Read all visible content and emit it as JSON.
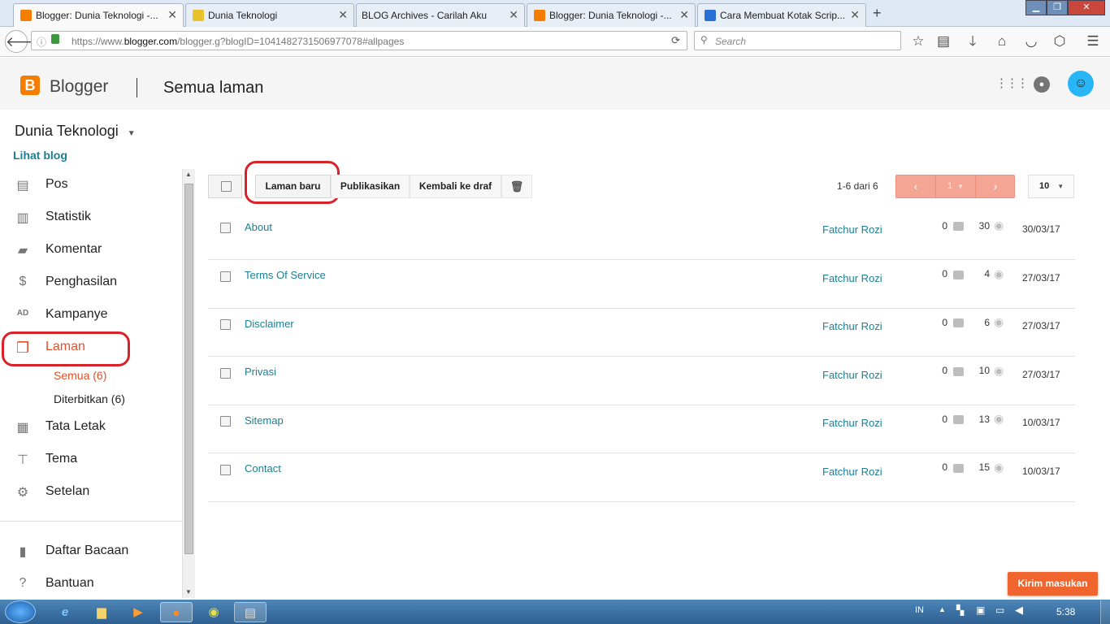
{
  "browser": {
    "tabs": [
      {
        "title": "Blogger: Dunia Teknologi -...",
        "active": true,
        "favicon": "blogger-icon"
      },
      {
        "title": "Dunia Teknologi",
        "active": false,
        "favicon": "page-icon"
      },
      {
        "title": "BLOG Archives - Carilah Aku",
        "active": false,
        "favicon": "none"
      },
      {
        "title": "Blogger: Dunia Teknologi -...",
        "active": false,
        "favicon": "blogger-icon"
      },
      {
        "title": "Cara Membuat Kotak Scrip...",
        "active": false,
        "favicon": "d-icon"
      }
    ],
    "url_prefix": "https://www.",
    "url_domain": "blogger.com",
    "url_rest": "/blogger.g?blogID=1041482731506977078#allpages",
    "search_placeholder": "Search"
  },
  "header": {
    "brand": "Blogger",
    "page_title": "Semua laman"
  },
  "sidebar": {
    "blog_name": "Dunia Teknologi",
    "view_blog": "Lihat blog",
    "items": [
      {
        "label": "Pos",
        "icon": "posts-icon"
      },
      {
        "label": "Statistik",
        "icon": "stats-icon"
      },
      {
        "label": "Komentar",
        "icon": "comment-icon"
      },
      {
        "label": "Penghasilan",
        "icon": "dollar-icon"
      },
      {
        "label": "Kampanye",
        "icon": "ad-icon"
      },
      {
        "label": "Laman",
        "icon": "pages-icon",
        "active": true
      },
      {
        "label": "Tata Letak",
        "icon": "layout-icon"
      },
      {
        "label": "Tema",
        "icon": "paint-roller-icon"
      },
      {
        "label": "Setelan",
        "icon": "gear-icon"
      }
    ],
    "sub_items": [
      {
        "label": "Semua (6)",
        "active": true
      },
      {
        "label": "Diterbitkan (6)",
        "active": false
      }
    ],
    "bottom_items": [
      {
        "label": "Daftar Bacaan",
        "icon": "bookmark-icon"
      },
      {
        "label": "Bantuan",
        "icon": "help-icon"
      }
    ]
  },
  "toolbar": {
    "new_page": "Laman baru",
    "publish": "Publikasikan",
    "revert": "Kembali ke draf",
    "pager_text": "1-6 dari 6",
    "page_number": "1",
    "per_page": "10"
  },
  "pages": [
    {
      "title": "About",
      "author": "Fatchur Rozi",
      "comments": "0",
      "views": "30",
      "date": "30/03/17"
    },
    {
      "title": "Terms Of Service",
      "author": "Fatchur Rozi",
      "comments": "0",
      "views": "4",
      "date": "27/03/17"
    },
    {
      "title": "Disclaimer",
      "author": "Fatchur Rozi",
      "comments": "0",
      "views": "6",
      "date": "27/03/17"
    },
    {
      "title": "Privasi",
      "author": "Fatchur Rozi",
      "comments": "0",
      "views": "10",
      "date": "27/03/17"
    },
    {
      "title": "Sitemap",
      "author": "Fatchur Rozi",
      "comments": "0",
      "views": "13",
      "date": "10/03/17"
    },
    {
      "title": "Contact",
      "author": "Fatchur Rozi",
      "comments": "0",
      "views": "15",
      "date": "10/03/17"
    }
  ],
  "feedback_button": "Kirim masukan",
  "taskbar": {
    "language": "IN",
    "clock": "5:38"
  },
  "colors": {
    "accent_orange": "#f57d00",
    "link_teal": "#1a7f92",
    "active_red": "#e0502a",
    "annotation_red": "#d8232a",
    "pager_salmon": "#f4a594",
    "feedback_bg": "#f0642d"
  }
}
